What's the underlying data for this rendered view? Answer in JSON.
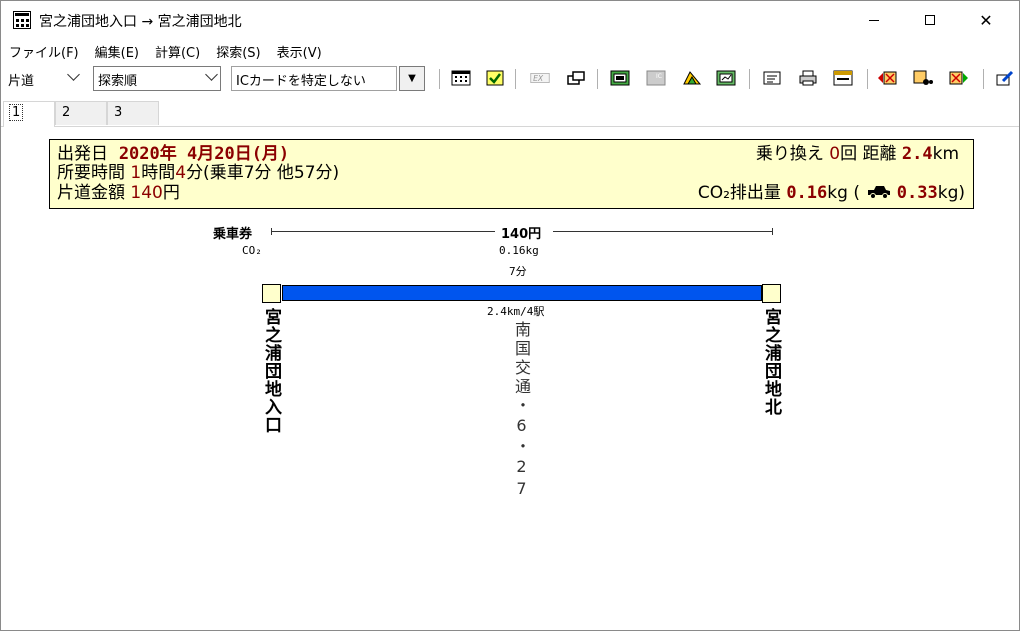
{
  "window": {
    "title": "宮之浦団地入口 → 宮之浦団地北",
    "minimize": "minimize",
    "maximize": "maximize",
    "close": "✕"
  },
  "menu": [
    "ファイル(F)",
    "編集(E)",
    "計算(C)",
    "探索(S)",
    "表示(V)"
  ],
  "toolbar": {
    "trip_type": "片道",
    "sort_order": "探索順",
    "ic_card": "ICカードを特定しない",
    "dropdown_arrow": "▼"
  },
  "tabs": [
    "1",
    "2",
    "3"
  ],
  "summary": {
    "date_label": "出発日",
    "date_value": "2020年 4月20日(月)",
    "time_label": "所要時間",
    "time_hours": "1",
    "time_h_unit": "時間",
    "time_minutes": "4",
    "time_rest": "分(乗車7分 他57分)",
    "fare_label": "片道金額",
    "fare_value": "140",
    "fare_unit": "円",
    "transfer_label": "乗り換え",
    "transfer_count": "0",
    "transfer_unit": "回",
    "distance_label": "距離",
    "distance_value": "2.4",
    "distance_unit": "km",
    "co2_label": "CO₂排出量",
    "co2_value": "0.16",
    "co2_unit": "kg",
    "co2_paren_open": "(",
    "car_value": "0.33",
    "car_unit": "kg)"
  },
  "route": {
    "ticket_label": "乗車券",
    "fare": "140円",
    "co2_label": "CO₂",
    "co2": "0.16kg",
    "ride_time": "7分",
    "distance_stations": "2.4km/4駅",
    "origin": "宮之浦団地入口",
    "line": "南国交通・6・27",
    "destination": "宮之浦団地北"
  },
  "colors": {
    "summary_bg": "#ffffcc",
    "value_red": "#8b0000",
    "route_blue": "#0055ee"
  }
}
